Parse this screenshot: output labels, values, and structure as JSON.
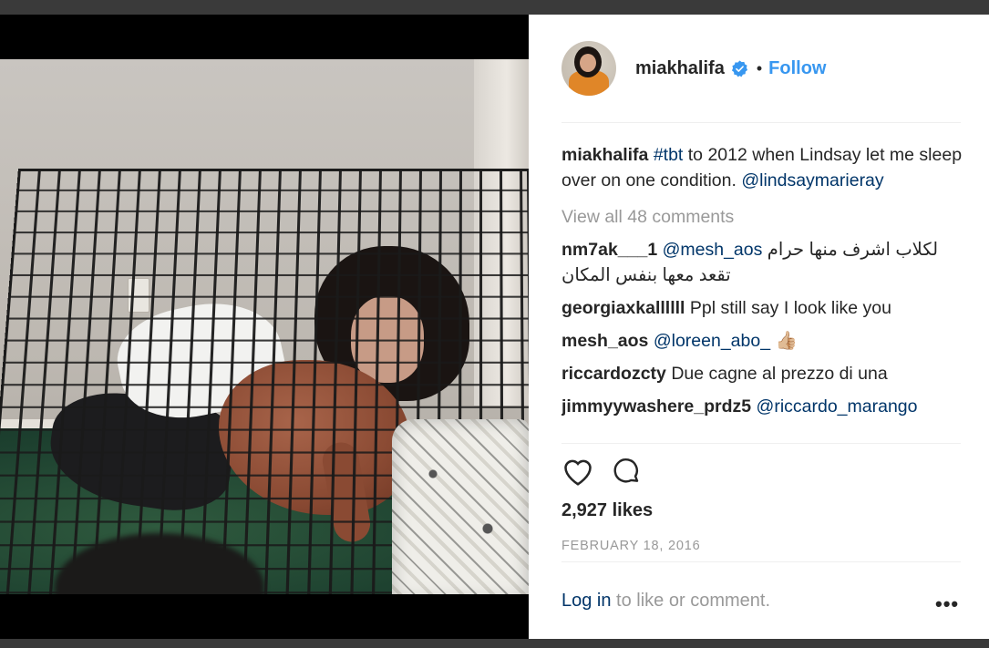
{
  "post": {
    "username": "miakhalifa",
    "verified": true,
    "follow_label": "Follow",
    "dot": "•",
    "caption": {
      "username": "miakhalifa",
      "hashtag": "#tbt",
      "text": " to 2012 when Lindsay let me sleep over on one condition. ",
      "mention": "@lindsaymarieray"
    },
    "view_all_comments": "View all 48 comments",
    "comments": [
      {
        "username": "nm7ak___1",
        "mention": "@mesh_aos",
        "text": "لكلاب اشرف منها حرام تقعد معها بنفس المكان"
      },
      {
        "username": "georgiaxkallllll",
        "mention": "",
        "text": "Ppl still say I look like you"
      },
      {
        "username": "mesh_aos",
        "mention": "@loreen_abo_",
        "text": "👍🏼"
      },
      {
        "username": "riccardozcty",
        "mention": "",
        "text": "Due cagne al prezzo di una"
      },
      {
        "username": "jimmyywashere_prdz5",
        "mention": "@riccardo_marango",
        "text": ""
      }
    ],
    "likes": "2,927 likes",
    "date": "FEBRUARY 18, 2016",
    "login_link": "Log in",
    "login_text": " to like or comment.",
    "more_label": "•••",
    "colors": {
      "link_blue": "#3897f0",
      "mention_navy": "#003569",
      "text": "#262626",
      "muted": "#999999"
    },
    "icons": [
      "verified-badge-icon",
      "heart-icon",
      "comment-icon",
      "more-options-icon"
    ]
  }
}
